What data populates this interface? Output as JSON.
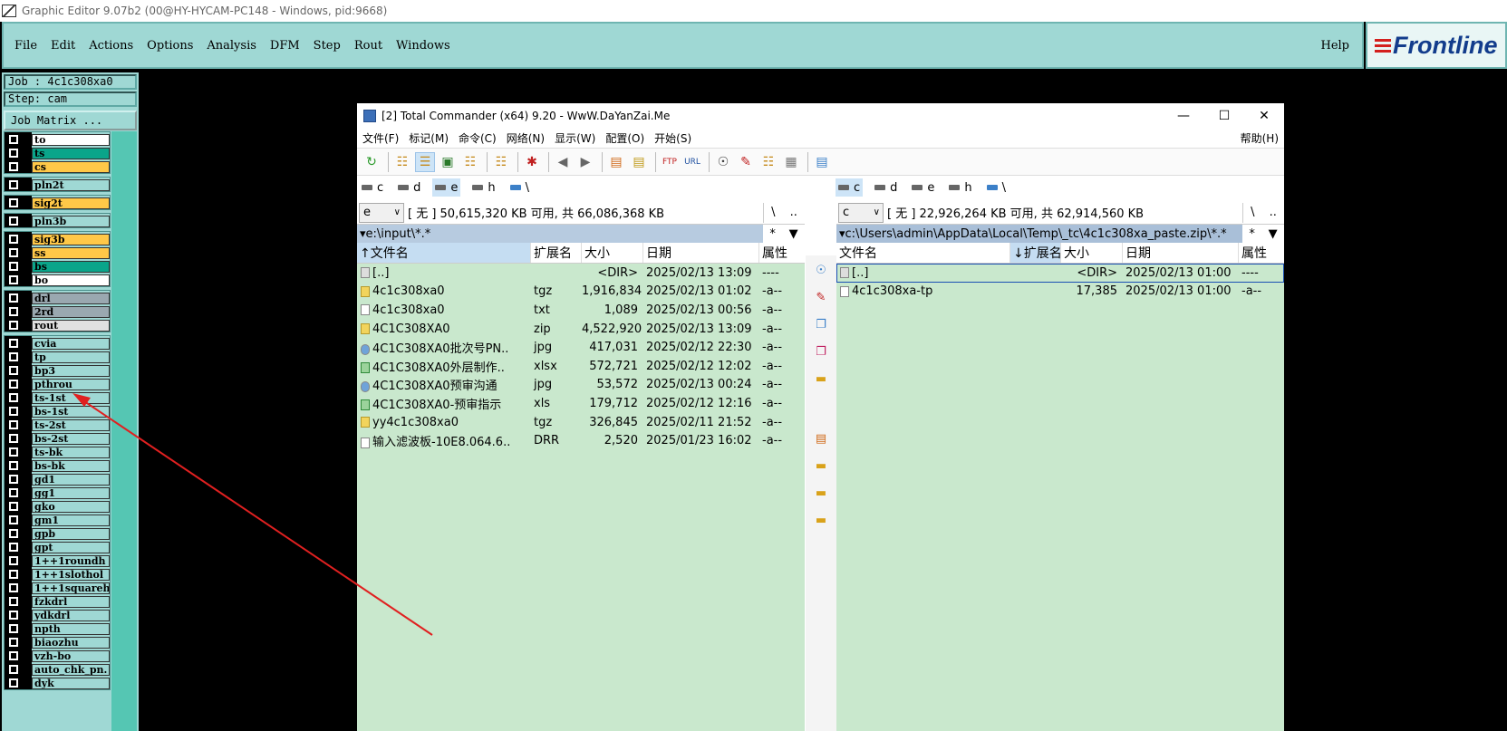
{
  "app": {
    "title": "Graphic Editor 9.07b2 (00@HY-HYCAM-PC148 - Windows, pid:9668)"
  },
  "menu": [
    "File",
    "Edit",
    "Actions",
    "Options",
    "Analysis",
    "DFM",
    "Step",
    "Rout",
    "Windows"
  ],
  "help": "Help",
  "logo": "Frontline",
  "job": {
    "label": "Job : 4c1c308xa0",
    "step": "Step: cam",
    "matrix_button": "Job Matrix ..."
  },
  "layer_groups": [
    [
      {
        "name": "to",
        "color": "#ffffff"
      },
      {
        "name": "ts",
        "color": "#0aa58a"
      },
      {
        "name": "cs",
        "color": "#ffc848"
      }
    ],
    [
      {
        "name": "pln2t",
        "color": "#9fd8d4"
      }
    ],
    [
      {
        "name": "sig2t",
        "color": "#ffc848"
      }
    ],
    [
      {
        "name": "pln3b",
        "color": "#9fd8d4"
      }
    ],
    [
      {
        "name": "sig3b",
        "color": "#ffc848"
      },
      {
        "name": "ss",
        "color": "#ffc848"
      },
      {
        "name": "bs",
        "color": "#0aa58a"
      },
      {
        "name": "bo",
        "color": "#ffffff"
      }
    ],
    [
      {
        "name": "drl",
        "color": "#9aa8b0"
      },
      {
        "name": "2rd",
        "color": "#9aa8b0"
      },
      {
        "name": "rout",
        "color": "#e0e0e0"
      }
    ],
    [
      {
        "name": "cvia",
        "color": "#9fd8d4"
      },
      {
        "name": "tp",
        "color": "#9fd8d4"
      },
      {
        "name": "bp3",
        "color": "#9fd8d4"
      },
      {
        "name": "pthrou",
        "color": "#9fd8d4"
      },
      {
        "name": "ts-1st",
        "color": "#9fd8d4"
      },
      {
        "name": "bs-1st",
        "color": "#9fd8d4"
      },
      {
        "name": "ts-2st",
        "color": "#9fd8d4"
      },
      {
        "name": "bs-2st",
        "color": "#9fd8d4"
      },
      {
        "name": "ts-bk",
        "color": "#9fd8d4"
      },
      {
        "name": "bs-bk",
        "color": "#9fd8d4"
      },
      {
        "name": "gd1",
        "color": "#9fd8d4"
      },
      {
        "name": "gg1",
        "color": "#9fd8d4"
      },
      {
        "name": "gko",
        "color": "#9fd8d4"
      },
      {
        "name": "gm1",
        "color": "#9fd8d4"
      },
      {
        "name": "gpb",
        "color": "#9fd8d4"
      },
      {
        "name": "gpt",
        "color": "#9fd8d4"
      },
      {
        "name": "1++1roundh",
        "color": "#9fd8d4"
      },
      {
        "name": "1++1slothol",
        "color": "#9fd8d4"
      },
      {
        "name": "1++1squarehe",
        "color": "#9fd8d4"
      },
      {
        "name": "fzkdrl",
        "color": "#9fd8d4"
      },
      {
        "name": "ydkdrl",
        "color": "#9fd8d4"
      },
      {
        "name": "npth",
        "color": "#9fd8d4"
      },
      {
        "name": "biaozhu",
        "color": "#9fd8d4"
      },
      {
        "name": "vzh-bo",
        "color": "#9fd8d4"
      },
      {
        "name": "auto_chk_pn.",
        "color": "#9fd8d4"
      },
      {
        "name": "dyk",
        "color": "#9fd8d4"
      }
    ]
  ],
  "tc": {
    "title": "[2] Total Commander (x64) 9.20 - WwW.DaYanZai.Me",
    "controls": [
      "—",
      "☐",
      "✕"
    ],
    "menu": [
      "文件(F)",
      "标记(M)",
      "命令(C)",
      "网络(N)",
      "显示(W)",
      "配置(O)",
      "开始(S)"
    ],
    "menu_help": "帮助(H)",
    "drives": [
      "c",
      "d",
      "e",
      "h",
      "\\"
    ],
    "left": {
      "drive": "e",
      "info": "[ 无 ]  50,615,320 KB 可用,  共 66,086,368 KB",
      "nav": [
        "\\",
        ".."
      ],
      "path": "e:\\input\\*.*",
      "filter": [
        "*",
        "▼"
      ],
      "headers": [
        "↑文件名",
        "扩展名",
        "大小",
        "日期",
        "属性"
      ],
      "files": [
        {
          "name": "[..]",
          "ext": "",
          "size": "<DIR>",
          "date": "2025/02/13 13:09",
          "attr": "----",
          "icon": "up"
        },
        {
          "name": "4c1c308xa0",
          "ext": "tgz",
          "size": "1,916,834",
          "date": "2025/02/13 01:02",
          "attr": "-a--",
          "icon": "arc"
        },
        {
          "name": "4c1c308xa0",
          "ext": "txt",
          "size": "1,089",
          "date": "2025/02/13 00:56",
          "attr": "-a--",
          "icon": "doc"
        },
        {
          "name": "4C1C308XA0",
          "ext": "zip",
          "size": "4,522,920",
          "date": "2025/02/13 13:09",
          "attr": "-a--",
          "icon": "arc"
        },
        {
          "name": "4C1C308XA0批次号PN..",
          "ext": "jpg",
          "size": "417,031",
          "date": "2025/02/12 22:30",
          "attr": "-a--",
          "icon": "img"
        },
        {
          "name": "4C1C308XA0外层制作..",
          "ext": "xlsx",
          "size": "572,721",
          "date": "2025/02/12 12:02",
          "attr": "-a--",
          "icon": "xls"
        },
        {
          "name": "4C1C308XA0预审沟通",
          "ext": "jpg",
          "size": "53,572",
          "date": "2025/02/13 00:24",
          "attr": "-a--",
          "icon": "img"
        },
        {
          "name": "4C1C308XA0-预审指示",
          "ext": "xls",
          "size": "179,712",
          "date": "2025/02/12 12:16",
          "attr": "-a--",
          "icon": "xls"
        },
        {
          "name": "yy4c1c308xa0",
          "ext": "tgz",
          "size": "326,845",
          "date": "2025/02/11 21:52",
          "attr": "-a--",
          "icon": "arc"
        },
        {
          "name": "输入滤波板-10E8.064.6..",
          "ext": "DRR",
          "size": "2,520",
          "date": "2025/01/23 16:02",
          "attr": "-a--",
          "icon": "doc"
        }
      ]
    },
    "right": {
      "drive": "c",
      "info": "[ 无 ]  22,926,264 KB 可用,  共 62,914,560 KB",
      "nav": [
        "\\",
        ".."
      ],
      "path": "c:\\Users\\admin\\AppData\\Local\\Temp\\_tc\\4c1c308xa_paste.zip\\*.*",
      "filter": [
        "*",
        "▼"
      ],
      "headers": [
        "文件名",
        "↓扩展名",
        "大小",
        "日期",
        "属性"
      ],
      "files": [
        {
          "name": "[..]",
          "ext": "",
          "size": "<DIR>",
          "date": "2025/02/13 01:00",
          "attr": "----",
          "icon": "up"
        },
        {
          "name": "4c1c308xa-tp",
          "ext": "",
          "size": "17,385",
          "date": "2025/02/13 01:00",
          "attr": "-a--",
          "icon": "doc"
        }
      ]
    }
  },
  "colors": {
    "panel": "#9fd8d4",
    "annotation": "#e02020",
    "tc_file_bg": "#c9e8cd"
  }
}
